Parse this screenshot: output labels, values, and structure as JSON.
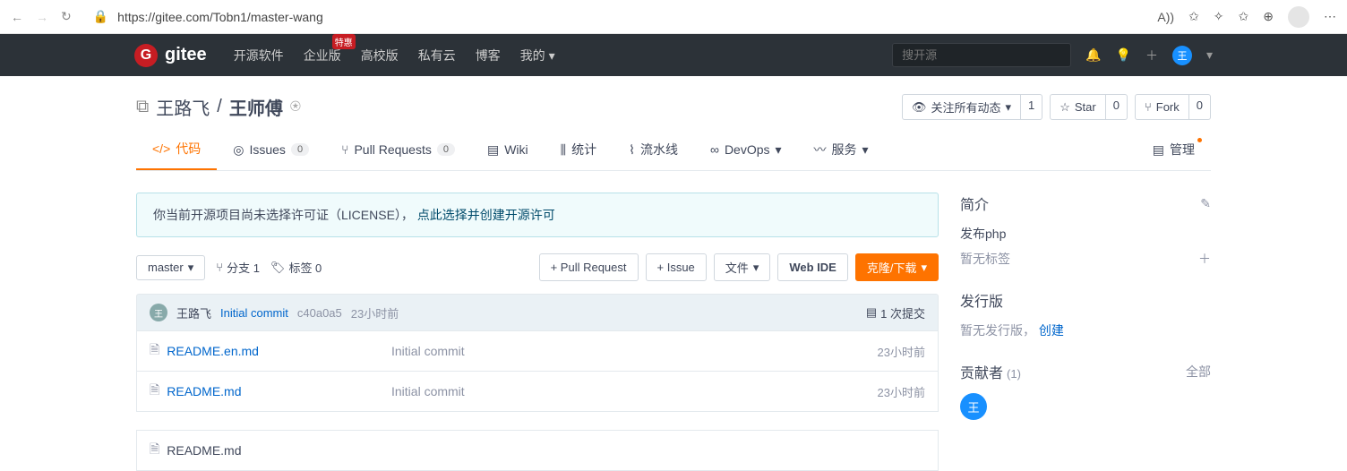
{
  "browser": {
    "url": "https://gitee.com/Tobn1/master-wang",
    "font_indicator": "A))"
  },
  "nav": {
    "brand": "gitee",
    "links": [
      "开源软件",
      "企业版",
      "高校版",
      "私有云",
      "博客",
      "我的"
    ],
    "badge_on": "企业版",
    "badge_text": "特惠",
    "search_placeholder": "搜开源",
    "avatar_letter": "王"
  },
  "repo": {
    "owner": "王路飞",
    "name": "王师傅",
    "watch_label": "关注所有动态",
    "watch_count": "1",
    "star_label": "Star",
    "star_count": "0",
    "fork_label": "Fork",
    "fork_count": "0"
  },
  "tabs": {
    "code": "代码",
    "issues": "Issues",
    "issues_count": "0",
    "pr": "Pull Requests",
    "pr_count": "0",
    "wiki": "Wiki",
    "stats": "统计",
    "pipeline": "流水线",
    "devops": "DevOps",
    "service": "服务",
    "manage": "管理"
  },
  "banner": {
    "prefix": "你当前开源项目尚未选择许可证（LICENSE），",
    "link": "点此选择并创建开源许可"
  },
  "toolbar": {
    "branch_btn": "master",
    "branch_stat": "分支 1",
    "tag_stat": "标签 0",
    "pr_btn": "+ Pull Request",
    "issue_btn": "+ Issue",
    "file_btn": "文件",
    "webide_btn": "Web IDE",
    "clone_btn": "克隆/下载"
  },
  "commit": {
    "author": "王路飞",
    "message": "Initial commit",
    "sha": "c40a0a5",
    "time": "23小时前",
    "count": "1 次提交",
    "avatar": "王"
  },
  "files": [
    {
      "name": "README.en.md",
      "msg": "Initial commit",
      "time": "23小时前"
    },
    {
      "name": "README.md",
      "msg": "Initial commit",
      "time": "23小时前"
    }
  ],
  "readme": {
    "title": "README.md"
  },
  "sidebar": {
    "intro_title": "简介",
    "intro_text": "发布php",
    "no_tags": "暂无标签",
    "release_title": "发行版",
    "no_release": "暂无发行版，",
    "create": "创建",
    "contrib_title": "贡献者",
    "contrib_count": "(1)",
    "all": "全部",
    "contrib_avatar": "王"
  }
}
